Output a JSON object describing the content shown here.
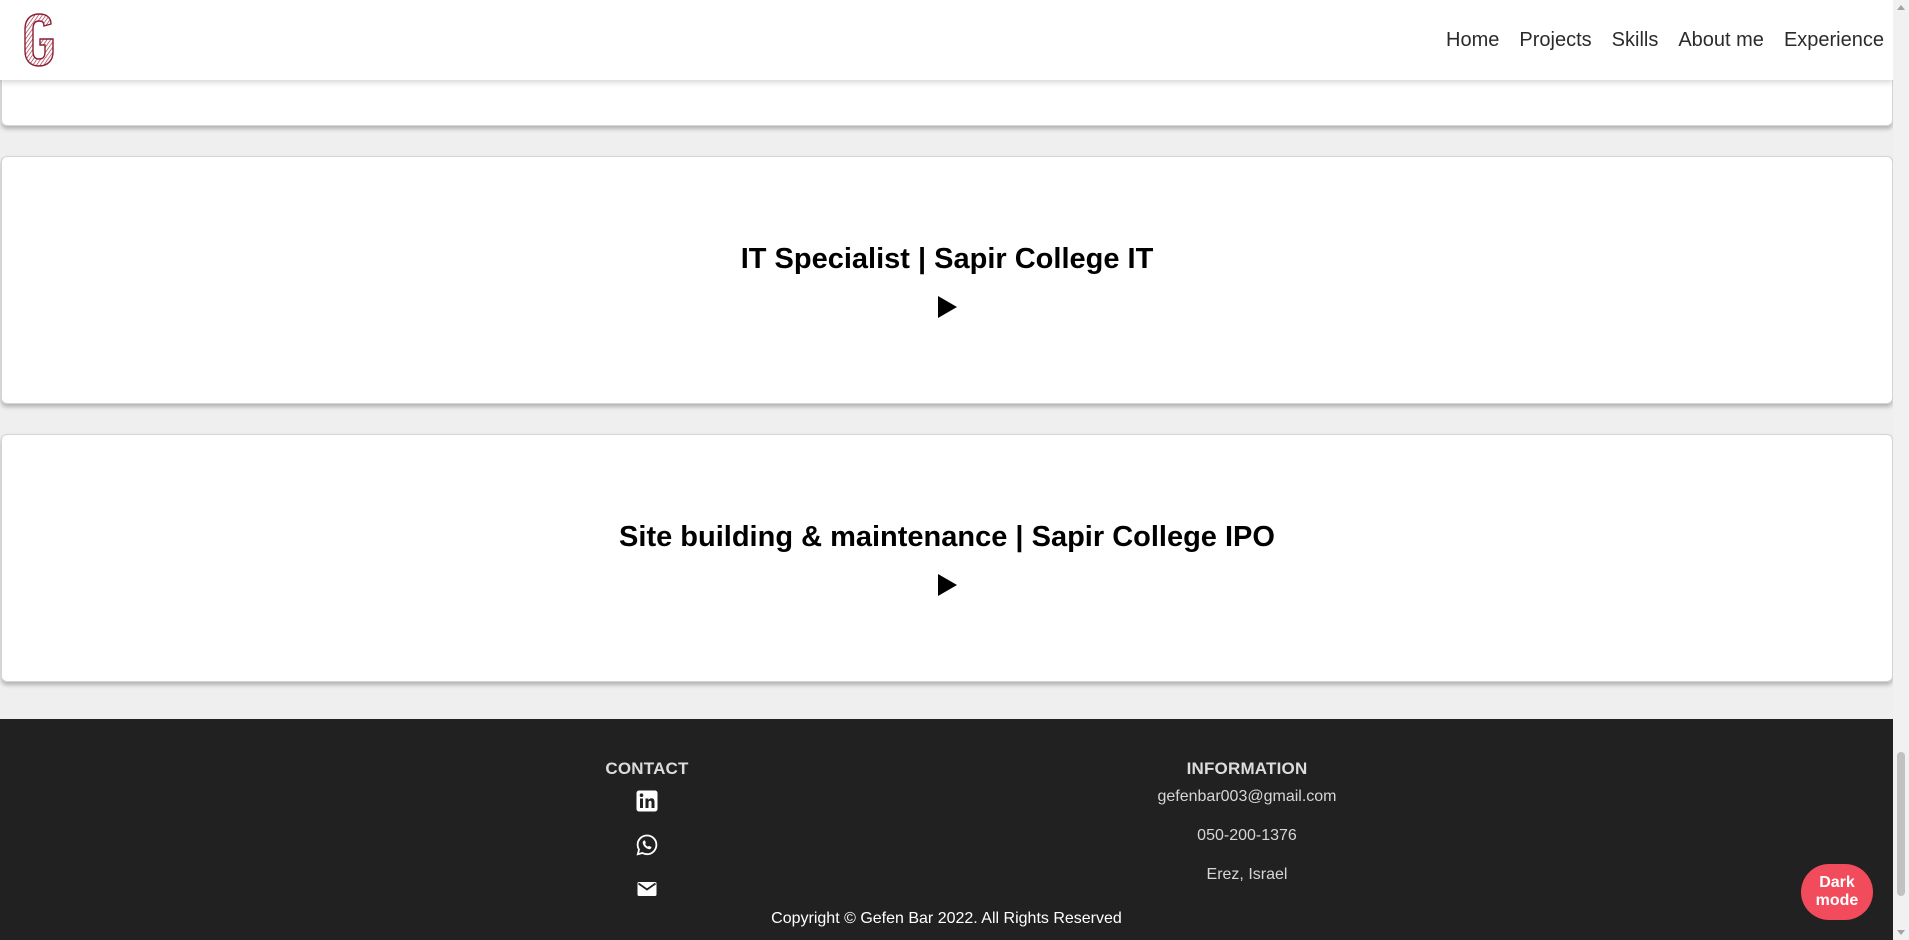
{
  "nav": {
    "logo_letter": "G",
    "items": [
      "Home",
      "Projects",
      "Skills",
      "About me",
      "Experience"
    ]
  },
  "experience": [
    {
      "title": "IT Specialist | Sapir College IT"
    },
    {
      "title": "Site building & maintenance | Sapir College IPO"
    }
  ],
  "footer": {
    "contact": {
      "heading": "CONTACT",
      "icons": [
        "linkedin-icon",
        "whatsapp-icon",
        "mail-icon"
      ]
    },
    "information": {
      "heading": "INFORMATION",
      "email": "gefenbar003@gmail.com",
      "phone": "050-200-1376",
      "location": "Erez, Israel"
    },
    "copyright": "Copyright © Gefen Bar 2022. All Rights Reserved"
  },
  "dark_mode_button": "Dark mode",
  "colors": {
    "accent": "#f24b5c",
    "footer_bg": "#212121",
    "logo": "#a3243b"
  }
}
